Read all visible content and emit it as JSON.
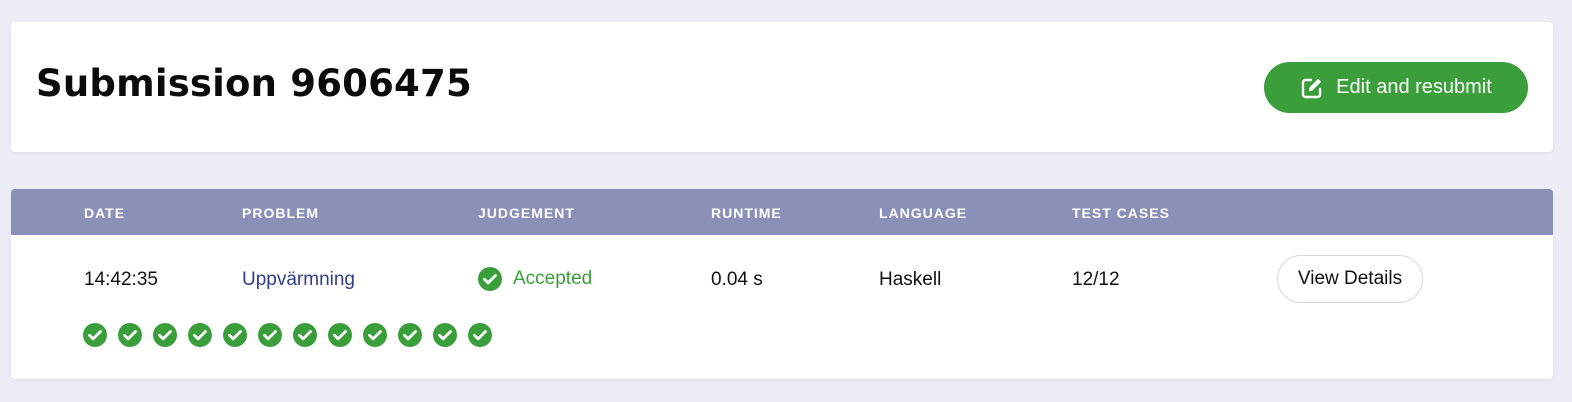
{
  "header": {
    "title": "Submission 9606475",
    "edit_button_label": "Edit and resubmit",
    "edit_icon": "edit-icon"
  },
  "table": {
    "columns": [
      "DATE",
      "PROBLEM",
      "JUDGEMENT",
      "RUNTIME",
      "LANGUAGE",
      "TEST CASES"
    ],
    "row": {
      "date": "14:42:35",
      "problem": "Uppvärmning",
      "judgement": "Accepted",
      "runtime": "0.04 s",
      "language": "Haskell",
      "test_cases": "12/12",
      "view_details_label": "View Details"
    },
    "test_case_results": [
      "accepted",
      "accepted",
      "accepted",
      "accepted",
      "accepted",
      "accepted",
      "accepted",
      "accepted",
      "accepted",
      "accepted",
      "accepted",
      "accepted"
    ]
  },
  "colors": {
    "accent_green": "#3a9e3a",
    "table_header": "#8a90b8",
    "link": "#2f3e86",
    "background": "#ecedf5"
  }
}
